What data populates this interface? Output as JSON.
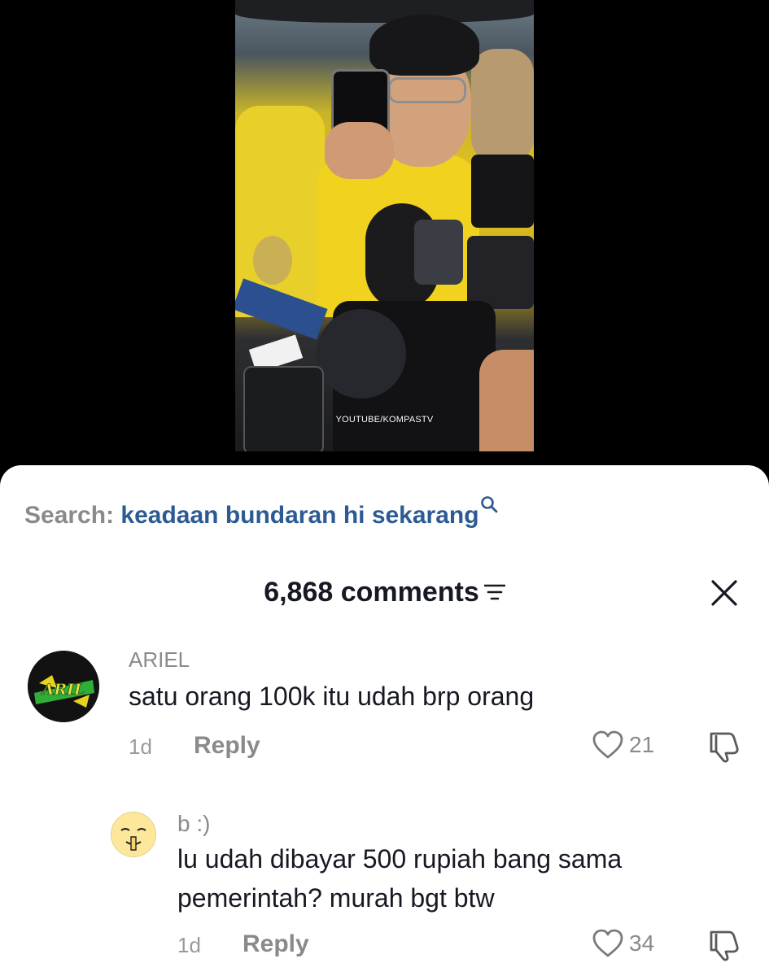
{
  "video": {
    "watermark": "YOUTUBE/KOMPASTV"
  },
  "search": {
    "label": "Search:",
    "query": "keadaan bundaran hi sekarang"
  },
  "comments_header": {
    "title": "6,868 comments"
  },
  "comments": [
    {
      "username": "ARIEL",
      "avatar_text": "ARIL",
      "text": "satu orang 100k itu udah brp orang",
      "time": "1d",
      "reply_label": "Reply",
      "likes": "21"
    },
    {
      "username": "b :)",
      "text": "lu udah dibayar 500 rupiah bang sama pemerintah? murah bgt btw",
      "time": "1d",
      "reply_label": "Reply",
      "likes": "34"
    }
  ],
  "colors": {
    "search_query": "#2c5a93",
    "muted": "#8a8a8a",
    "text": "#161823"
  }
}
